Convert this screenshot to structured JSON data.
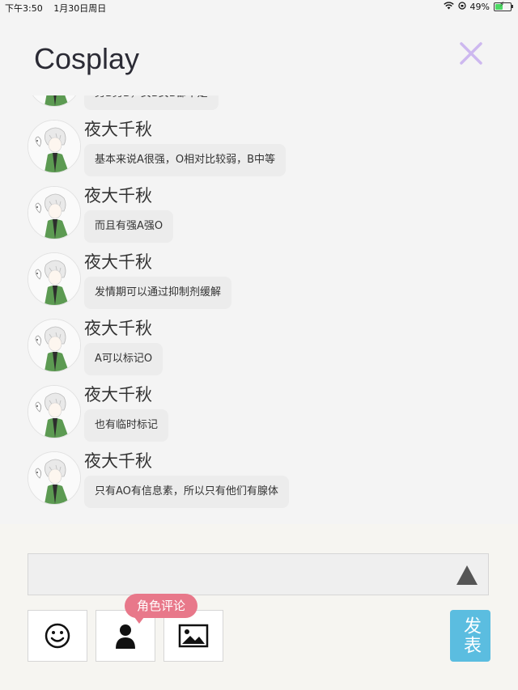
{
  "status_bar": {
    "time": "下午3:50",
    "date": "1月30日周日",
    "battery_percent": "49%",
    "battery_level": 0.49
  },
  "header": {
    "title": "Cosplay",
    "close_icon": "close-x-icon",
    "accent_color": "#cdb8ef"
  },
  "messages": [
    {
      "name": "",
      "text": "男B男B，女B女B都不是"
    },
    {
      "name": "夜大千秋",
      "text": "基本来说A很强，O相对比较弱，B中等"
    },
    {
      "name": "夜大千秋",
      "text": "而且有强A强O"
    },
    {
      "name": "夜大千秋",
      "text": "发情期可以通过抑制剂缓解"
    },
    {
      "name": "夜大千秋",
      "text": "A可以标记O"
    },
    {
      "name": "夜大千秋",
      "text": "也有临时标记"
    },
    {
      "name": "夜大千秋",
      "text": "只有AO有信息素，所以只有他们有腺体"
    }
  ],
  "composer": {
    "input_value": "",
    "send_icon": "triangle-send-icon",
    "tools": [
      {
        "icon": "smiley-icon"
      },
      {
        "icon": "person-icon"
      },
      {
        "icon": "image-icon"
      }
    ],
    "tooltip": "角色评论",
    "post_label": "发表",
    "post_color": "#5bbde0",
    "tooltip_color": "#e8788a"
  }
}
